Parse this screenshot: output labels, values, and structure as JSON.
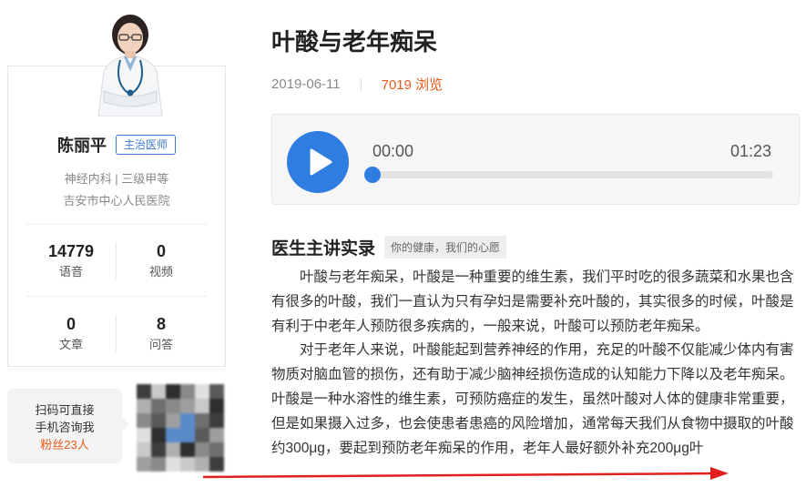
{
  "doctor": {
    "name": "陈丽平",
    "title": "主治医师",
    "department": "神经内科 | 三级甲等",
    "hospital": "吉安市中心人民医院",
    "stats": [
      {
        "value": "14779",
        "label": "语音"
      },
      {
        "value": "0",
        "label": "视频"
      },
      {
        "value": "0",
        "label": "文章"
      },
      {
        "value": "8",
        "label": "问答"
      }
    ]
  },
  "consult": {
    "line1": "扫码可直接",
    "line2": "手机咨询我",
    "fans": "粉丝23人"
  },
  "article": {
    "title": "叶酸与老年痴呆",
    "date": "2019-06-11",
    "views": "7019 浏览",
    "audio": {
      "current_time": "00:00",
      "total_time": "01:23",
      "progress": 0
    },
    "section_title": "医生主讲实录",
    "section_tag": "你的健康，我们的心愿",
    "paragraphs": [
      "叶酸与老年痴呆，叶酸是一种重要的维生素，我们平时吃的很多蔬菜和水果也含有很多的叶酸，我们一直认为只有孕妇是需要补充叶酸的，其实很多的时候，叶酸是有利于中老年人预防很多疾病的，一般来说，叶酸可以预防老年痴呆。",
      "对于老年人来说，叶酸能起到营养神经的作用，充足的叶酸不仅能减少体内有害物质对脑血管的损伤，还有助于减少脑神经损伤造成的认知能力下降以及老年痴呆。叶酸是一种水溶性的维生素，可预防癌症的发生，虽然叶酸对人体的健康非常重要，但是如果摄入过多，也会使患者患癌的风险增加，通常每天我们从食物中摄取的叶酸约300μg，要起到预防老年痴呆的作用，老年人最好额外补充200μg叶"
    ]
  },
  "colors": {
    "accent_blue": "#2f7de1",
    "views_orange": "#e8591a",
    "annotation_red": "#e0201c"
  },
  "icons": {
    "play": "play-icon",
    "annotation_arrow": "red-arrow-annotation"
  }
}
